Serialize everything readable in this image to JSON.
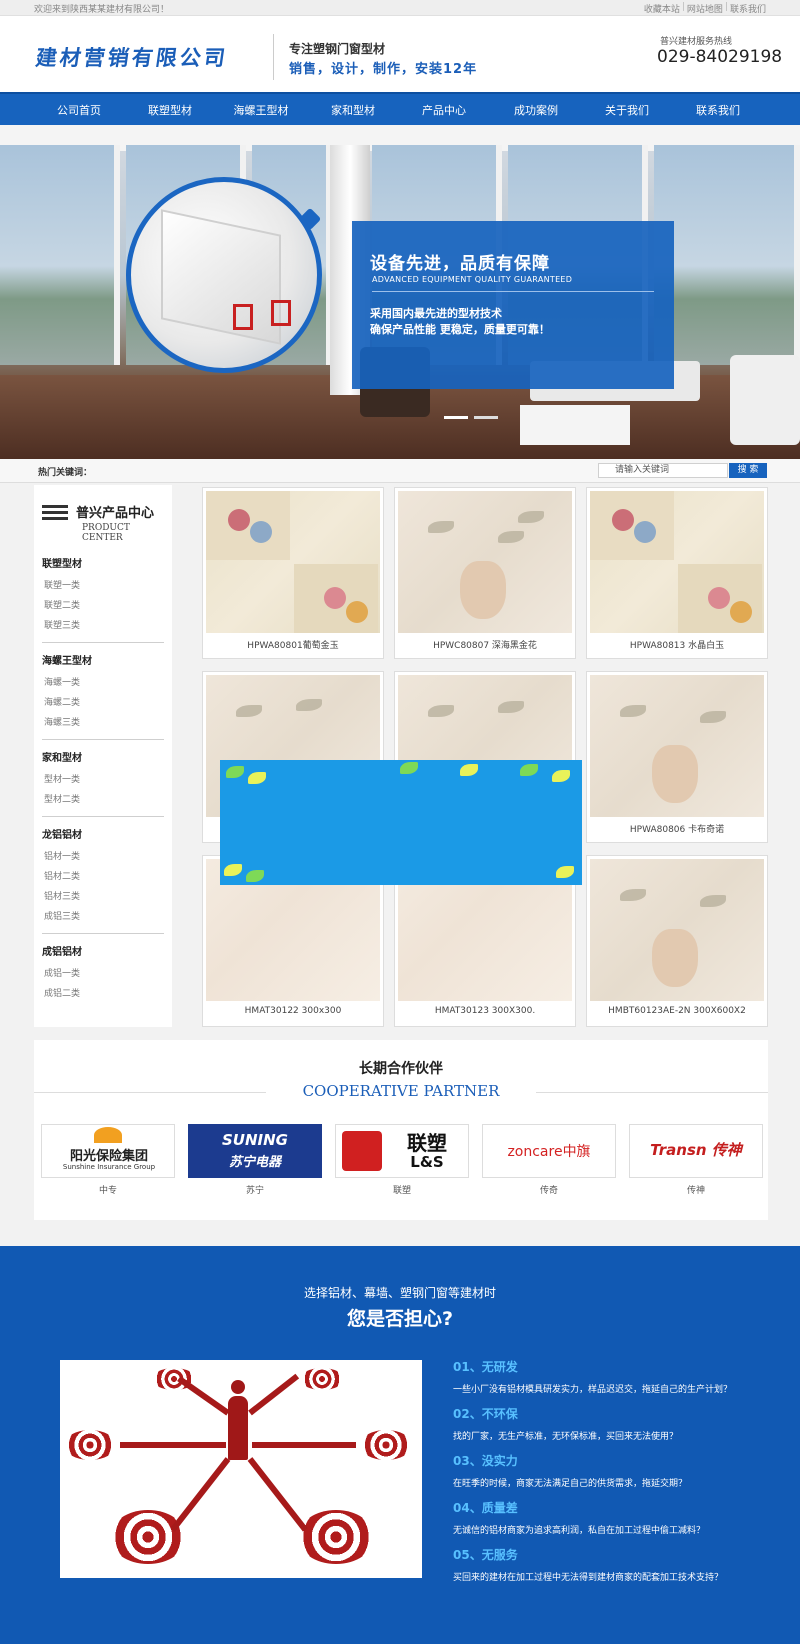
{
  "topbar": {
    "welcome": "欢迎来到陕西某某建材有限公司！",
    "links": [
      "收藏本站",
      "网站地图",
      "联系我们"
    ]
  },
  "header": {
    "logo_text": "建材营销有限公司",
    "slogan_line1": "专注塑钢门窗型材",
    "slogan_line2": "销售，设计，制作，安装12年",
    "hotline_label": "普兴建材服务热线",
    "hotline_number": "029-84029198"
  },
  "nav": {
    "items": [
      "公司首页",
      "联塑型材",
      "海螺王型材",
      "家和型材",
      "产品中心",
      "成功案例",
      "关于我们",
      "联系我们"
    ]
  },
  "banner": {
    "title": "设备先进，品质有保障",
    "subtitle": "ADVANCED EQUIPMENT QUALITY GUARANTEED",
    "line1": "采用国内最先进的型材技术",
    "line2": "确保产品性能 更稳定，质量更可靠！",
    "slides": 2,
    "active_slide": 1
  },
  "search": {
    "hot_label": "热门关键词：",
    "placeholder": "请输入关键词",
    "button": "搜 索"
  },
  "sidebar": {
    "title": "普兴产品中心",
    "subtitle": "PRODUCT CENTER",
    "icon": "list-icon",
    "groups": [
      {
        "title": "联塑型材",
        "items": [
          "联塑一类",
          "联塑二类",
          "联塑三类"
        ]
      },
      {
        "title": "海螺王型材",
        "items": [
          "海螺一类",
          "海螺二类",
          "海螺三类"
        ]
      },
      {
        "title": "家和型材",
        "items": [
          "型材一类",
          "型材二类"
        ]
      },
      {
        "title": "龙铝铝材",
        "items": [
          "铝材一类",
          "铝材二类",
          "铝材三类",
          "成铝三类"
        ]
      },
      {
        "title": "成铝铝材",
        "items": [
          "成铝一类",
          "成铝二类"
        ]
      }
    ]
  },
  "products": [
    {
      "caption": "HPWA80801葡萄金玉"
    },
    {
      "caption": "HPWC80807 深海黑金花"
    },
    {
      "caption": "HPWA80813 水晶白玉"
    },
    {
      "caption": ""
    },
    {
      "caption": ""
    },
    {
      "caption": "HPWA80806 卡布奇诺"
    },
    {
      "caption": "HMAT30122 300x300"
    },
    {
      "caption": "HMAT30123 300X300."
    },
    {
      "caption": "HMBT60123AE-2N 300X600X2"
    }
  ],
  "partners": {
    "title": "长期合作伙伴",
    "subtitle": "COOPERATIVE PARTNER",
    "items": [
      {
        "logo_cn": "阳光保险集团",
        "logo_en": "Sunshine Insurance Group",
        "label": "中专"
      },
      {
        "logo_cn": "苏宁电器",
        "logo_en": "SUNING",
        "label": "苏宁"
      },
      {
        "logo_cn": "联塑",
        "logo_en": "L&S",
        "label": "联塑"
      },
      {
        "logo_cn": "中旗",
        "logo_en": "zoncare",
        "label": "传奇"
      },
      {
        "logo_cn": "传神",
        "logo_en": "Transn",
        "label": "传神"
      }
    ]
  },
  "worry": {
    "line1": "选择铝材、幕墙、塑钢门窗等建材时",
    "line2": "您是否担心?",
    "reasons": [
      {
        "title": "01、无研发",
        "desc": "一些小厂没有铝材模具研发实力，样品迟迟交，拖延自己的生产计划？"
      },
      {
        "title": "02、不环保",
        "desc": "找的厂家，无生产标准，无环保标准，买回来无法使用？"
      },
      {
        "title": "03、没实力",
        "desc": "在旺季的时候，商家无法满足自己的供货需求，拖延交期？"
      },
      {
        "title": "04、质量差",
        "desc": "无诚信的铝材商家为追求高利润，私自在加工过程中偷工减料？"
      },
      {
        "title": "05、无服务",
        "desc": "买回来的建材在加工过程中无法得到建材商家的配套加工技术支持？"
      }
    ]
  },
  "colors": {
    "brand_blue": "#1763be",
    "deep_blue": "#1159b3",
    "accent_light_blue": "#58c0ff",
    "target_red": "#b01c1c"
  }
}
